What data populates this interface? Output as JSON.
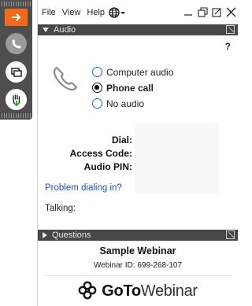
{
  "menu": {
    "file": "File",
    "view": "View",
    "help": "Help"
  },
  "window_controls": [
    "minimize-icon",
    "restore-icon",
    "popout-icon",
    "close-icon"
  ],
  "side_toolbar": {
    "buttons": [
      "arrow-right-icon",
      "phone-icon",
      "screen-share-icon",
      "raise-hand-icon"
    ],
    "accent_color": "#f26a1b"
  },
  "audio_section": {
    "title": "Audio",
    "help": "?",
    "options": [
      {
        "label": "Computer audio",
        "selected": false
      },
      {
        "label": "Phone call",
        "selected": true
      },
      {
        "label": "No audio",
        "selected": false
      }
    ],
    "dial_label": "Dial:",
    "access_code_label": "Access Code:",
    "audio_pin_label": "Audio PIN:",
    "problem_link": "Problem dialing in?",
    "talking_label": "Talking:"
  },
  "questions_section": {
    "title": "Questions"
  },
  "webinar": {
    "title": "Sample Webinar",
    "id_text": "Webinar ID: 699-268-107"
  },
  "brand": {
    "goto": "GoTo",
    "webinar": "Webinar",
    "color": "#111111"
  }
}
